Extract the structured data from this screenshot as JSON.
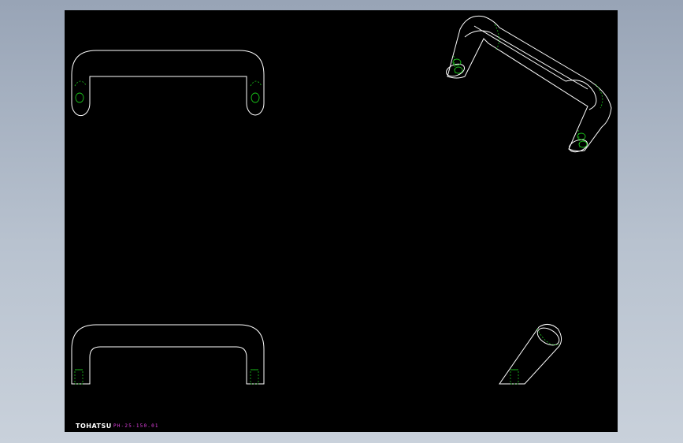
{
  "drawing": {
    "logo_text": "TOHATSU",
    "part_number": "PH-25-150.01",
    "colors": {
      "sheet": "#000000",
      "outline": "#ffffff",
      "hidden": "#19c419",
      "text_accent": "#e040e0"
    }
  }
}
